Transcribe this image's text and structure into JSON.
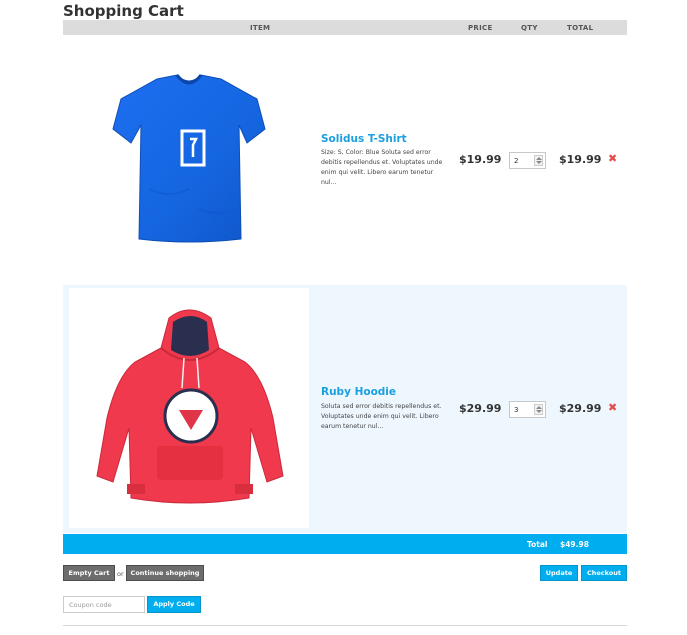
{
  "page": {
    "title": "Shopping Cart"
  },
  "table_header": {
    "item": "ITEM",
    "price": "PRICE",
    "qty": "QTY",
    "total": "TOTAL"
  },
  "items": [
    {
      "name": "Solidus T-Shirt",
      "description": "Size: S, Color: Blue Soluta sed error debitis repellendus et. Voluptates unde enim qui velit. Libero earum tenetur nul...",
      "price": "$19.99",
      "quantity": "2",
      "total": "$19.99",
      "remove": "✖",
      "image": "blue-tshirt-image",
      "color": "#1565e0"
    },
    {
      "name": "Ruby Hoodie",
      "description": "Soluta sed error debitis repellendus et. Voluptates unde enim qui velit. Libero earum tenetur nul...",
      "price": "$29.99",
      "quantity": "3",
      "total": "$29.99",
      "remove": "✖",
      "image": "red-hoodie-image",
      "color": "#ef3e4e"
    }
  ],
  "cart_total": {
    "label": "Total",
    "amount": "$49.98"
  },
  "actions": {
    "empty_cart": "Empty Cart",
    "or": "or",
    "continue_shopping": "Continue shopping",
    "update": "Update",
    "checkout": "Checkout"
  },
  "coupon": {
    "placeholder": "Coupon code",
    "apply": "Apply Code"
  },
  "colors": {
    "accent": "#00adee",
    "link": "#1a9fe0",
    "remove": "#e14d4d",
    "header_bg": "#dcdcdc",
    "alt_row": "#eef7fe"
  }
}
